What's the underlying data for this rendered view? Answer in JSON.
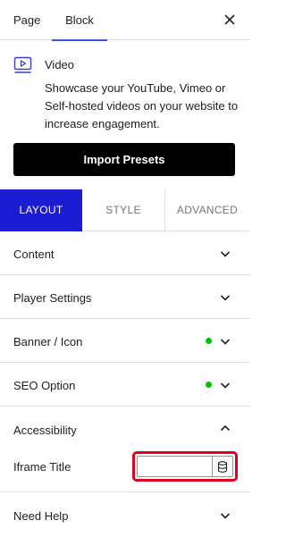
{
  "header": {
    "tabs": [
      {
        "label": "Page"
      },
      {
        "label": "Block",
        "active": true
      }
    ],
    "close_icon": "close-icon"
  },
  "block": {
    "icon": "video-icon",
    "title": "Video",
    "description": "Showcase your YouTube, Vimeo or Self-hosted videos on your website to increase engagement."
  },
  "import_button": {
    "label": "Import Presets"
  },
  "mode_tabs": [
    {
      "label": "LAYOUT",
      "active": true
    },
    {
      "label": "STYLE"
    },
    {
      "label": "ADVANCED"
    }
  ],
  "panels": [
    {
      "label": "Content",
      "expanded": false
    },
    {
      "label": "Player Settings",
      "expanded": false
    },
    {
      "label": "Banner / Icon",
      "expanded": false,
      "status": "active"
    },
    {
      "label": "SEO Option",
      "expanded": false,
      "status": "active"
    },
    {
      "label": "Accessibility",
      "expanded": true
    },
    {
      "label": "Need Help",
      "expanded": false
    }
  ],
  "accessibility": {
    "iframe_title_label": "Iframe Title",
    "iframe_title_value": "",
    "dynamic_icon": "database-icon"
  },
  "colors": {
    "accent": "#1c1cd2",
    "tab_underline": "#3858e9",
    "status_dot": "#00c000",
    "highlight": "#e0001e"
  }
}
